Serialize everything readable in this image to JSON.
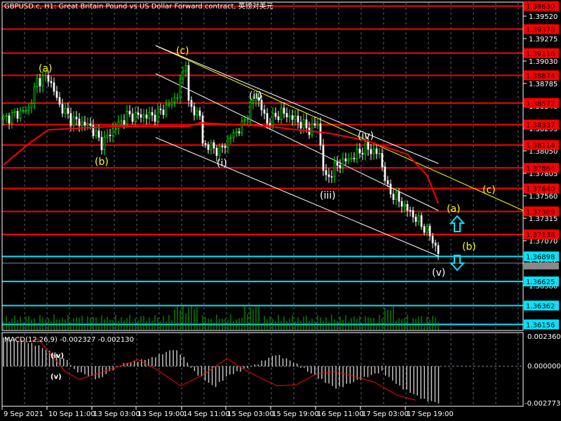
{
  "chart_data": {
    "type": "candlestick",
    "title": "GBPUSD.c, H1:  Great Britain Pound vs US Dollar Forward contract, 英镑对美元",
    "symbol": "GBPUSD.c",
    "timeframe": "H1",
    "price_axis_ticks": [
      "1.39520",
      "1.39275",
      "1.39030",
      "1.38785",
      "1.38540",
      "1.38295",
      "1.38050",
      "1.37805",
      "1.37560",
      "1.37315",
      "1.37070",
      "1.36825",
      "1.36580"
    ],
    "time_axis_ticks": [
      "9 Sep 2021",
      "10 Sep 11:00",
      "13 Sep 03:00",
      "13 Sep 19:00",
      "14 Sep 11:00",
      "15 Sep 03:00",
      "15 Sep 19:00",
      "16 Sep 11:00",
      "17 Sep 03:00",
      "17 Sep 19:00"
    ],
    "ylim": [
      1.361,
      1.3968
    ],
    "resistance_levels": [
      "1.39630",
      "1.39378",
      "1.39116",
      "1.38874",
      "1.38572",
      "1.38337",
      "1.38114",
      "1.37864",
      "1.37640",
      "1.37389",
      "1.37138"
    ],
    "support_levels": [
      "1.36898",
      "1.36625",
      "1.36362",
      "1.36156"
    ],
    "current_price": "1.36825",
    "resistance_color": "#ff0000",
    "support_color": "#00e5ff",
    "price_path": [
      [
        0,
        1.38395
      ],
      [
        9,
        1.38509
      ],
      [
        12,
        1.38816
      ],
      [
        16,
        1.38854
      ],
      [
        20,
        1.38548
      ],
      [
        24,
        1.38395
      ],
      [
        31,
        1.38318
      ],
      [
        35,
        1.38127
      ],
      [
        39,
        1.3828
      ],
      [
        44,
        1.38433
      ],
      [
        54,
        1.38433
      ],
      [
        59,
        1.38548
      ],
      [
        62,
        1.38663
      ],
      [
        65,
        1.39045
      ],
      [
        66,
        1.38548
      ],
      [
        70,
        1.38433
      ],
      [
        71,
        1.38127
      ],
      [
        77,
        1.3805
      ],
      [
        81,
        1.38203
      ],
      [
        85,
        1.38318
      ],
      [
        90,
        1.38663
      ],
      [
        94,
        1.38356
      ],
      [
        99,
        1.38471
      ],
      [
        104,
        1.38395
      ],
      [
        109,
        1.3828
      ],
      [
        112,
        1.38356
      ],
      [
        114,
        1.37859
      ],
      [
        115,
        1.37744
      ],
      [
        119,
        1.37897
      ],
      [
        124,
        1.37973
      ],
      [
        129,
        1.38088
      ],
      [
        134,
        1.38012
      ],
      [
        137,
        1.37629
      ],
      [
        142,
        1.37476
      ],
      [
        149,
        1.37246
      ],
      [
        152,
        1.37131
      ],
      [
        155,
        1.3694
      ]
    ],
    "moving_average": [
      [
        0,
        1.37897
      ],
      [
        9,
        1.38128
      ],
      [
        16,
        1.3828
      ],
      [
        40,
        1.38318
      ],
      [
        66,
        1.38318
      ],
      [
        70,
        1.38356
      ],
      [
        94,
        1.38318
      ],
      [
        116,
        1.38242
      ],
      [
        129,
        1.38165
      ],
      [
        144,
        1.38012
      ],
      [
        151,
        1.37782
      ],
      [
        155,
        1.37476
      ]
    ],
    "wave_labels": [
      {
        "text": "(a)",
        "color": "#ffff00"
      },
      {
        "text": "(b)",
        "color": "#ffff00"
      },
      {
        "text": "(c)",
        "color": "#ffff00"
      },
      {
        "text": "(i)",
        "color": "#ffffff"
      },
      {
        "text": "(ii)",
        "color": "#ffffff"
      },
      {
        "text": "(iii)",
        "color": "#ffffff"
      },
      {
        "text": "(iv)",
        "color": "#ffffff"
      },
      {
        "text": "(v)",
        "color": "#ffffff"
      },
      {
        "text": "(a)",
        "color": "#ffff00"
      },
      {
        "text": "(b)",
        "color": "#ffff00"
      },
      {
        "text": "(c)",
        "color": "#ffff00"
      }
    ],
    "macd": {
      "label": "MACD(12,26,9) -0.002327 -0.002130",
      "axis_ticks": [
        "0.002360",
        "0.000000",
        "-0.002773"
      ],
      "ylim": [
        -0.002773,
        0.00236
      ],
      "mini_labels": [
        "(iv)",
        "(v)"
      ],
      "histogram": [
        [
          0,
          0.0022
        ],
        [
          15,
          0.0019
        ],
        [
          25,
          0.0016
        ],
        [
          48,
          0.0004
        ],
        [
          52,
          -0.0003
        ],
        [
          70,
          -0.001
        ],
        [
          78,
          -0.0004
        ],
        [
          88,
          0.0002
        ],
        [
          108,
          0.0006
        ],
        [
          125,
          0.0013
        ],
        [
          131,
          0.0009
        ],
        [
          140,
          -0.0004
        ],
        [
          155,
          -0.0016
        ],
        [
          165,
          -0.0007
        ],
        [
          185,
          0.0001
        ],
        [
          200,
          0.0009
        ],
        [
          212,
          0.0004
        ],
        [
          230,
          -0.0008
        ],
        [
          245,
          -0.0017
        ],
        [
          262,
          -0.001
        ],
        [
          278,
          -0.0004
        ],
        [
          292,
          -0.0016
        ],
        [
          310,
          -0.0026
        ],
        [
          320,
          -0.0028
        ]
      ],
      "signal": [
        [
          18,
          0.0022
        ],
        [
          25,
          0.0019
        ],
        [
          35,
          0.0019
        ],
        [
          45,
          0.0021
        ],
        [
          60,
          0.001
        ],
        [
          80,
          -0.0004
        ],
        [
          98,
          -0.001
        ],
        [
          120,
          -0.0006
        ],
        [
          150,
          0.0
        ],
        [
          175,
          0.0005
        ],
        [
          200,
          -0.0003
        ],
        [
          230,
          -0.0015
        ],
        [
          260,
          -0.0006
        ],
        [
          290,
          0.0006
        ],
        [
          305,
          0.0
        ],
        [
          330,
          -0.0008
        ],
        [
          355,
          -0.0015
        ],
        [
          380,
          -0.0014
        ],
        [
          405,
          -0.0006
        ],
        [
          430,
          -0.0004
        ],
        [
          450,
          -0.0007
        ],
        [
          480,
          -0.0012
        ],
        [
          510,
          -0.0022
        ],
        [
          535,
          -0.0026
        ]
      ]
    }
  }
}
